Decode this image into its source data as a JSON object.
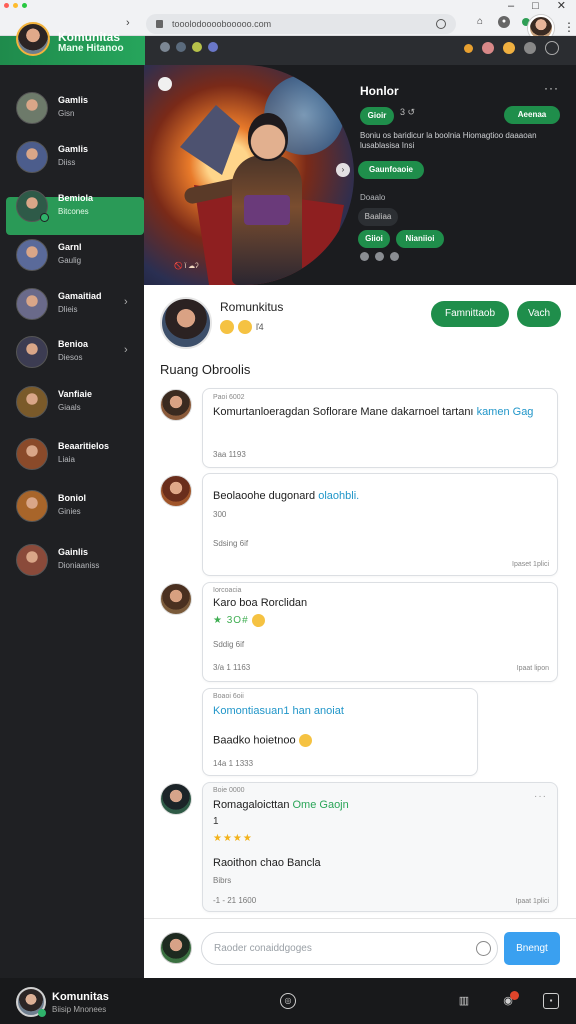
{
  "browser": {
    "address": "tooolodoooobooooo.com",
    "window_controls": [
      "–",
      "□",
      "✕"
    ]
  },
  "app": {
    "brand_title": "Komunitas",
    "brand_subtitle": "Mane Hitanoo"
  },
  "sidebar": {
    "items": [
      {
        "title": "Gamlis",
        "sub": "Gisn",
        "chevron": false,
        "active": false,
        "color": "#6d7a6a"
      },
      {
        "title": "Gamlis",
        "sub": "Diiss",
        "chevron": false,
        "active": false,
        "color": "#4c5d8c"
      },
      {
        "title": "Bemiola",
        "sub": "Bitcones",
        "chevron": false,
        "active": true,
        "color": "#2e5a48"
      },
      {
        "title": "Garnl",
        "sub": "Gaulig",
        "chevron": false,
        "active": false,
        "color": "#5a6a9a"
      },
      {
        "title": "Gamaitiad",
        "sub": "Dlieis",
        "chevron": true,
        "active": false,
        "color": "#6a6a8a"
      },
      {
        "title": "Benioa",
        "sub": "Diesos",
        "chevron": true,
        "active": false,
        "color": "#3c3c52"
      },
      {
        "title": "Vanfiaie",
        "sub": "Giaals",
        "chevron": false,
        "active": false,
        "color": "#7a5a2a"
      },
      {
        "title": "Beaaritielos",
        "sub": "Liaia",
        "chevron": false,
        "active": false,
        "color": "#8a4a2a"
      },
      {
        "title": "Boniol",
        "sub": "Ginies",
        "chevron": false,
        "active": false,
        "color": "#a8652a"
      },
      {
        "title": "Gainlis",
        "sub": "Dioniaaniss",
        "chevron": false,
        "active": false,
        "color": "#8a4a3a"
      }
    ]
  },
  "hero": {
    "title": "Honlor",
    "pill_1": "Gioir",
    "meta": "3 ↺",
    "action": "Aeenaa",
    "description": "Boniu os baridicur la boolnia Hiomagtioo daaaoan lusablasisa Insi",
    "pill_2": "Gaunfoaoie",
    "line_1": "Doaalo",
    "pill_3": "Baaliaa",
    "pill_4": "Giioi",
    "pill_5": "Nianiioi",
    "art_caption": "🚫 ǐ ☁ʔ"
  },
  "community": {
    "name": "Romunkitus",
    "emoji_count": "ľ4",
    "join_label": "Famnittaob",
    "follow_label": "Vach",
    "chat_title": "Ruang Obroolis"
  },
  "messages": [
    {
      "sender": "Paoi 6002",
      "text": "Komurtanloeragdan Soflorare Mane dakarnoel tartanı",
      "highlight": "kamen Gag",
      "meta": "3aa 1193",
      "right": ""
    },
    {
      "sender": "",
      "text": "Beolaoohe dugonard",
      "highlight": "olaohbli.",
      "line_2": "300",
      "meta": "Sdsing 6if",
      "right": "Ipaset 1plici"
    },
    {
      "sender": "Iorcoacia",
      "text": "Karo boa Rorclidan",
      "stars": "★ 3O#",
      "meta": "Sddig 6if",
      "meta_2": "3/a 1 1163",
      "right": "Ipaat lipon"
    },
    {
      "sender": "Boaoi 6oii",
      "text": "Komontiasuan1 han anoiat",
      "line_2": "Baadko hoietnoo",
      "meta": "14a 1 1333",
      "right": ""
    },
    {
      "sender": "Boie 0000",
      "text": "Romagaloicttan",
      "highlight": "Ome Gaojn",
      "line_2": "1",
      "stars": "★★★★",
      "line_3": "Raoithon chao Bancla",
      "line_4": "Bibrs",
      "meta": "-1 - 21 1600",
      "right": "Ipaat 1plici"
    }
  ],
  "composer": {
    "placeholder": "Raoder conaiddgoges",
    "send_label": "Bnengt"
  },
  "bottombar": {
    "title": "Komunitas",
    "subtitle": "Biisip Mnonees"
  }
}
